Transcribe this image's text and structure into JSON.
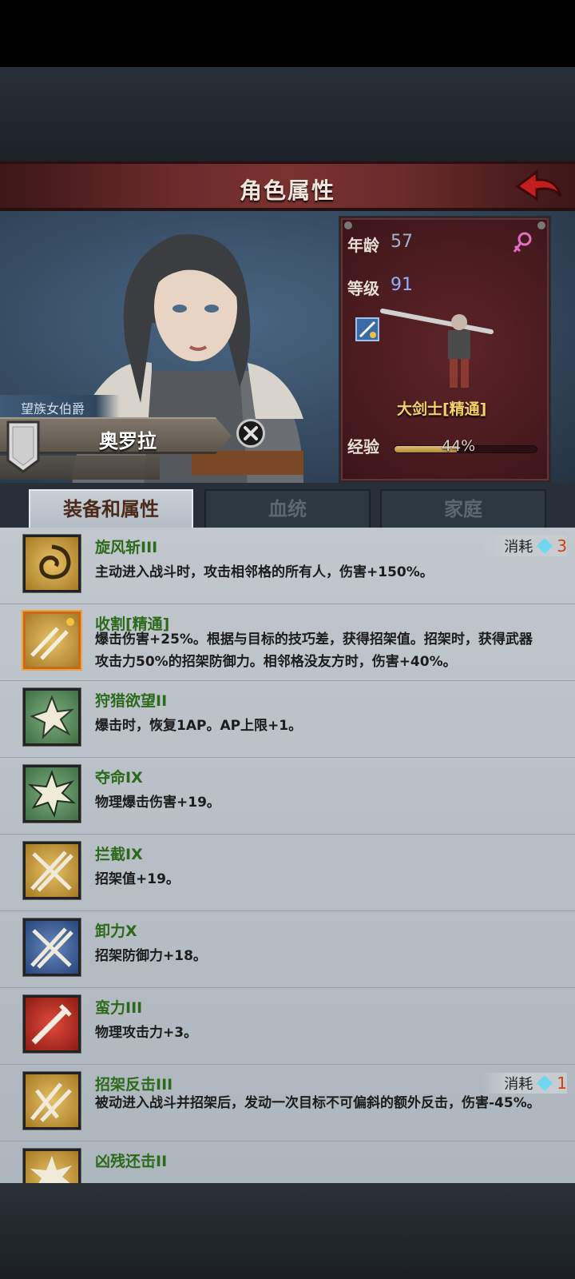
{
  "header": {
    "title": "角色属性"
  },
  "character": {
    "title": "望族女伯爵",
    "name": "奥罗拉"
  },
  "stats": {
    "age_label": "年龄",
    "age_value": "57",
    "level_label": "等级",
    "level_value": "91",
    "class_name": "大剑士[精通]",
    "exp_label": "经验",
    "exp_text": "44%",
    "exp_fraction": 0.44
  },
  "tabs": [
    {
      "label": "装备和属性",
      "active": true
    },
    {
      "label": "血统",
      "active": false
    },
    {
      "label": "家庭",
      "active": false
    }
  ],
  "skills": [
    {
      "name": "旋风斩III",
      "desc": "主动进入战斗时，攻击相邻格的所有人，伤害+150%。",
      "cost_label": "消耗",
      "cost_value": "3",
      "icon": "whirlwind-icon"
    },
    {
      "name": "收割[精通]",
      "desc": "爆击伤害+25%。根据与目标的技巧差，获得招架值。招架时，获得武器攻击力50%的招架防御力。相邻格没友方时，伤害+40%。",
      "icon": "harvest-icon"
    },
    {
      "name": "狩猎欲望II",
      "desc": "爆击时，恢复1AP。AP上限+1。",
      "icon": "hunt-desire-icon"
    },
    {
      "name": "夺命IX",
      "desc": "物理爆击伤害+19。",
      "icon": "lethal-icon"
    },
    {
      "name": "拦截IX",
      "desc": "招架值+19。",
      "icon": "intercept-icon"
    },
    {
      "name": "卸力X",
      "desc": "招架防御力+18。",
      "icon": "deflect-icon"
    },
    {
      "name": "蛮力III",
      "desc": "物理攻击力+3。",
      "icon": "brute-force-icon"
    },
    {
      "name": "招架反击III",
      "desc": "被动进入战斗并招架后，发动一次目标不可偏斜的额外反击，伤害-45%。",
      "cost_label": "消耗",
      "cost_value": "1",
      "icon": "parry-counter-icon"
    },
    {
      "name": "凶残还击II",
      "icon": "brutal-riposte-icon"
    }
  ]
}
